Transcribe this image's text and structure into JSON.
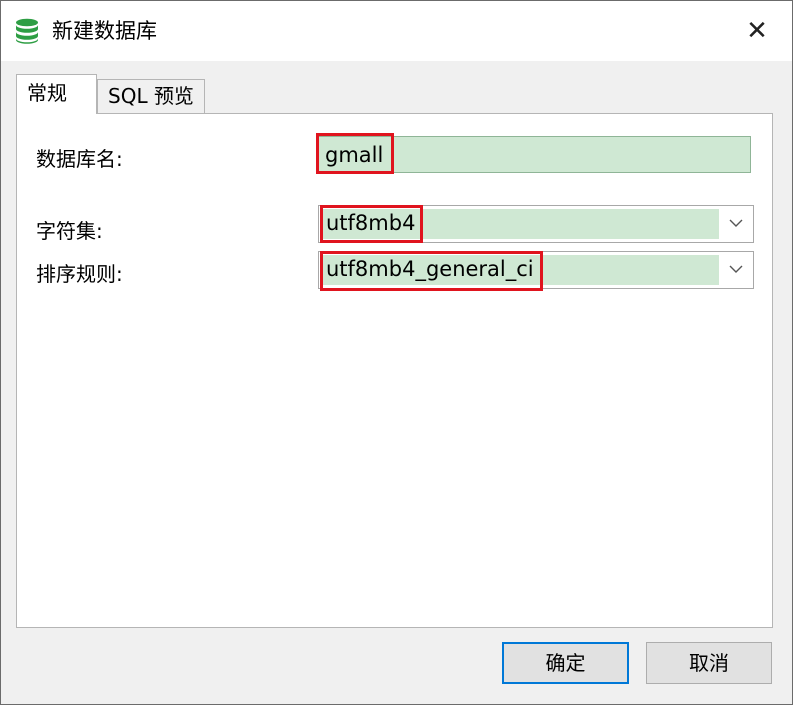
{
  "window": {
    "title": "新建数据库",
    "close_glyph": "✕",
    "icon": "database-icon"
  },
  "tabs": [
    {
      "label": "常规",
      "active": true
    },
    {
      "label": "SQL 预览",
      "active": false
    }
  ],
  "form": {
    "db_name_label": "数据库名:",
    "db_name_value": "gmall",
    "charset_label": "字符集:",
    "charset_value": "utf8mb4",
    "collation_label": "排序规则:",
    "collation_value": "utf8mb4_general_ci"
  },
  "buttons": {
    "ok": "确定",
    "cancel": "取消"
  },
  "colors": {
    "field_fill": "#cfe8d3",
    "highlight": "#e0141e",
    "icon": "#2e9e44",
    "default_button_border": "#0078d7"
  }
}
